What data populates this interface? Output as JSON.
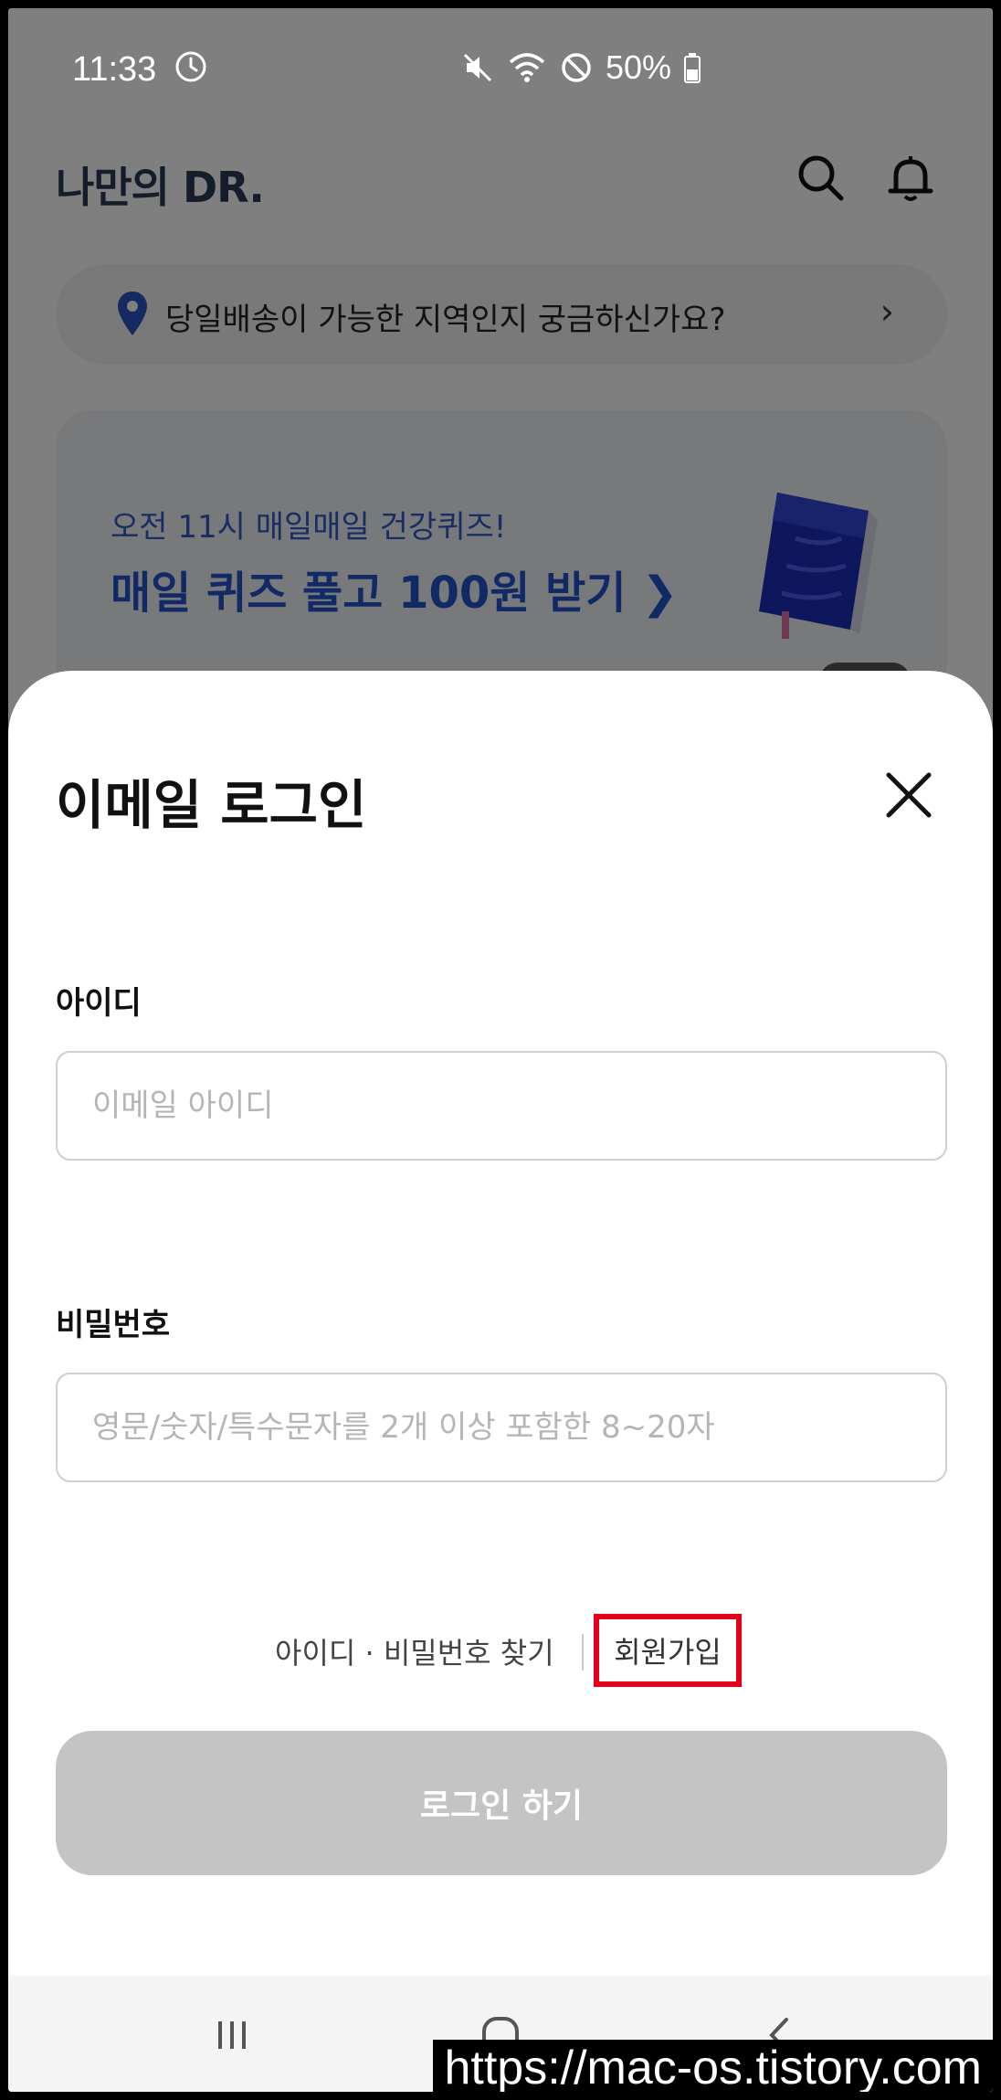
{
  "status_bar": {
    "time": "11:33",
    "battery": "50%",
    "icons": [
      "clock-icon",
      "mute-icon",
      "wifi-icon",
      "do-not-disturb-icon",
      "battery-icon"
    ]
  },
  "background_app": {
    "logo": "나만의 DR.",
    "header_icons": [
      "search-icon",
      "bell-icon"
    ],
    "delivery_prompt": "당일배송이 가능한 지역인지 궁금하신가요?",
    "banner": {
      "subtitle": "오전 11시 매일매일 건강퀴즈!",
      "title": "매일 퀴즈 풀고 100원 받기 ❯"
    }
  },
  "login_sheet": {
    "title": "이메일 로그인",
    "id_label": "아이디",
    "id_placeholder": "이메일 아이디",
    "password_label": "비밀번호",
    "password_placeholder": "영문/숫자/특수문자를 2개 이상 포함한 8~20자",
    "find_link": "아이디 · 비밀번호 찾기",
    "signup_link": "회원가입",
    "login_button": "로그인 하기",
    "highlight_color": "#e4001b",
    "disabled_button_color": "#c4c4c4"
  },
  "nav_bar": {
    "icons": [
      "recent-apps-icon",
      "home-icon",
      "back-icon"
    ]
  },
  "watermark": "https://mac-os.tistory.com"
}
